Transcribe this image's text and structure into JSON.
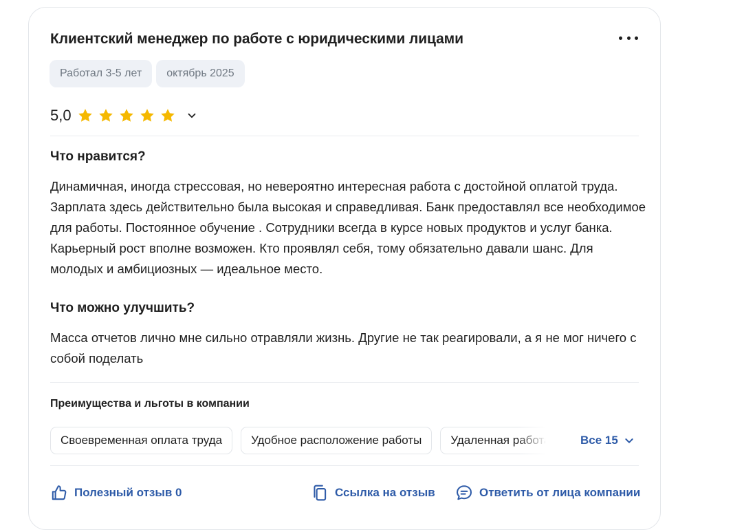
{
  "review": {
    "title": "Клиентский менеджер по работе с юридическими лицами",
    "tags": [
      "Работал 3-5 лет",
      "октябрь 2025"
    ],
    "rating": "5,0",
    "rating_stars": 5,
    "star_color": "#f5b800",
    "likes_heading": "Что нравится?",
    "likes_text": "Динамичная, иногда стрессовая, но невероятно интересная работа с достойной оплатой труда. Зарплата здесь действительно была высокая и справедливая. Банк предоставлял все необходимое для работы. Постоянное обучение . Сотрудники всегда в курсе новых продуктов и услуг банка. Карьерный рост вполне возможен. Кто проявлял себя, тому обязательно давали шанс. Для молодых и амбициозных — идеальное место.",
    "improve_heading": "Что можно улучшить?",
    "improve_text": "Масса отчетов лично мне сильно отравляли жизнь. Другие не так реагировали, а я не мог ничего с собой поделать",
    "benefits_heading": "Преимущества и льготы в компании",
    "benefits": [
      "Своевременная оплата труда",
      "Удобное расположение работы",
      "Удаленная работа"
    ],
    "all_benefits_label": "Все 15"
  },
  "actions": {
    "helpful": "Полезный отзыв 0",
    "link": "Ссылка на отзыв",
    "reply": "Ответить от лица компании"
  },
  "icons": {
    "menu": "more-dots-icon",
    "star": "star-icon",
    "chevron": "chevron-down-icon",
    "thumb": "thumbs-up-icon",
    "copy": "copy-icon",
    "chat": "chat-bubble-icon"
  },
  "colors": {
    "accent": "#2e5ba8",
    "tag_bg": "#eef1f6",
    "tag_text": "#6f7882"
  }
}
